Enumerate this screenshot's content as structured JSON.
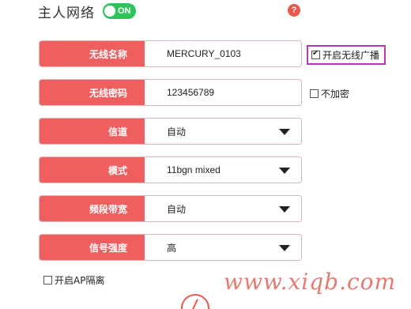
{
  "header": {
    "title": "主人网络",
    "toggle_label": "ON"
  },
  "help": {
    "symbol": "?"
  },
  "rows": [
    {
      "label": "无线名称",
      "value": "MERCURY_0103",
      "type": "input"
    },
    {
      "label": "无线密码",
      "value": "123456789",
      "type": "input"
    },
    {
      "label": "信道",
      "value": "自动",
      "type": "select"
    },
    {
      "label": "模式",
      "value": "11bgn mixed",
      "type": "select"
    },
    {
      "label": "频段带宽",
      "value": "自动",
      "type": "select"
    },
    {
      "label": "信号强度",
      "value": "高",
      "type": "select"
    }
  ],
  "options": {
    "broadcast": {
      "label": "开启无线广播",
      "checked": true
    },
    "no_encrypt": {
      "label": "不加密",
      "checked": false
    },
    "ap_isolation": {
      "label": "开启AP隔离",
      "checked": false
    }
  },
  "watermark": "www.xiqb.com",
  "colors": {
    "accent": "#f05f5f",
    "toggle_on": "#2fc45a",
    "highlight": "#b23ab8"
  }
}
